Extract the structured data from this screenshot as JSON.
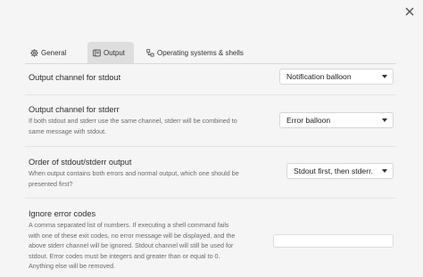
{
  "dialog": {
    "close_icon": "close-icon"
  },
  "tabs": [
    {
      "label": "General",
      "icon": "gear-icon",
      "active": false
    },
    {
      "label": "Output",
      "icon": "output-panel-icon",
      "active": true
    },
    {
      "label": "Operating systems & shells",
      "icon": "os-shells-icon",
      "active": false
    }
  ],
  "settings": {
    "stdout_channel": {
      "label": "Output channel for stdout",
      "value": "Notification balloon"
    },
    "stderr_channel": {
      "label": "Output channel for stderr",
      "description": "If both stdout and stderr use the same channel, stderr will be combined to same message with stdout.",
      "desc_lines": [
        "If both stdout and stderr use the same channel, stderr will be combined to",
        "same message with stdout."
      ],
      "value": "Error balloon"
    },
    "output_order": {
      "label": "Order of stdout/stderr output",
      "desc_lines": [
        "When output contains both errors and normal output, which one should be",
        "presented first?"
      ],
      "value": "Stdout first, then stderr."
    },
    "ignore_error_codes": {
      "label": "Ignore error codes",
      "desc_lines": [
        "A comma separated list of numbers. If executing a shell command fails",
        "with one of these exit codes, no error message will be displayed, and the",
        "above stderr channel will be ignored. Stdout channel will still be used for",
        "stdout. Error codes must be integers and greater than or equal to 0.",
        "Anything else will be removed."
      ],
      "value": ""
    }
  }
}
